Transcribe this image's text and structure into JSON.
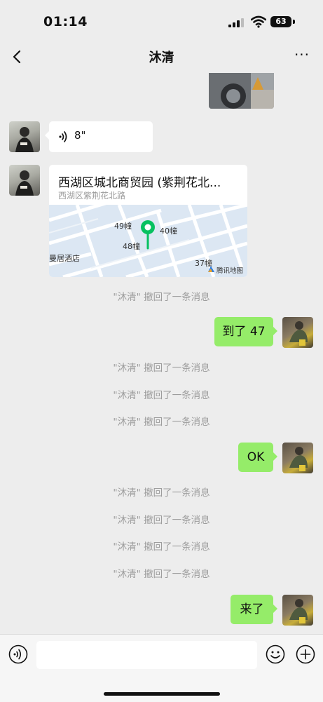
{
  "status_bar": {
    "time": "01:14",
    "battery": "63"
  },
  "nav": {
    "title": "沐清",
    "more": "···"
  },
  "voice_message": {
    "duration": "8\""
  },
  "location": {
    "title": "西湖区城北商贸园 (紫荆花北...",
    "subtitle": "西湖区紫荆花北路",
    "map_labels": [
      "49幢",
      "40幢",
      "48幢",
      "曼居酒店",
      "37幢",
      "腾讯地图"
    ]
  },
  "system_messages": {
    "recall": "\"沐清\" 撤回了一条消息"
  },
  "sent_messages": [
    "到了 47",
    "OK",
    "来了"
  ],
  "colors": {
    "sent_bubble": "#95ec69",
    "pin": "#07c160",
    "background": "#ededed"
  }
}
